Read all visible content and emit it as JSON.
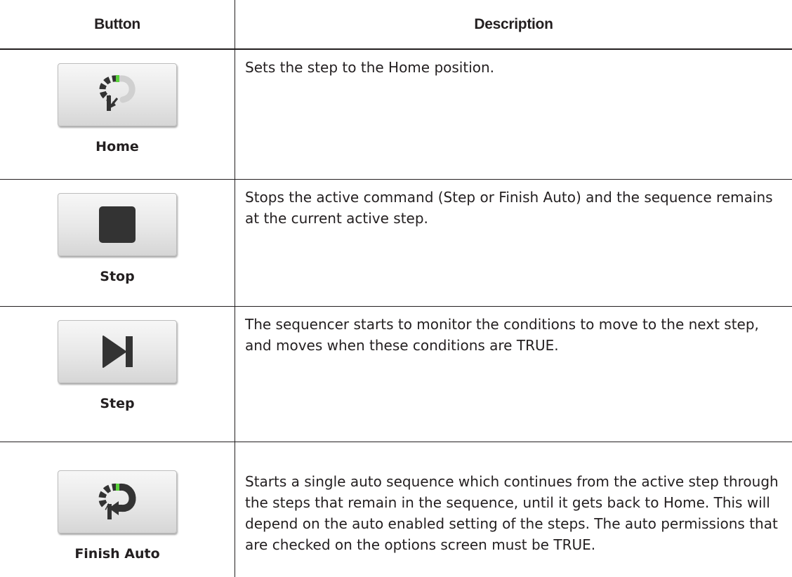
{
  "table": {
    "headers": {
      "button": "Button",
      "description": "Description"
    },
    "rows": [
      {
        "label": "Home",
        "icon": "home-icon",
        "description": "Sets the step to the Home position."
      },
      {
        "label": "Stop",
        "icon": "stop-icon",
        "description": "Stops the active command (Step or Finish Auto) and the sequence remains at the current active step."
      },
      {
        "label": "Step",
        "icon": "step-icon",
        "description": "The sequencer starts to monitor the conditions to move to the next step, and moves when these conditions are TRUE."
      },
      {
        "label": "Finish Auto",
        "icon": "finish-auto-icon",
        "description": "Starts a single auto sequence which continues from the active step through the steps that remain in the sequence, until it gets back to Home. This will depend on the auto enabled setting of the steps. The auto permissions that are checked on the options screen must be TRUE."
      }
    ]
  },
  "colors": {
    "text": "#231f20",
    "icon": "#333333",
    "accent_green": "#5ad23c",
    "button_face": "#e7e7e7"
  }
}
